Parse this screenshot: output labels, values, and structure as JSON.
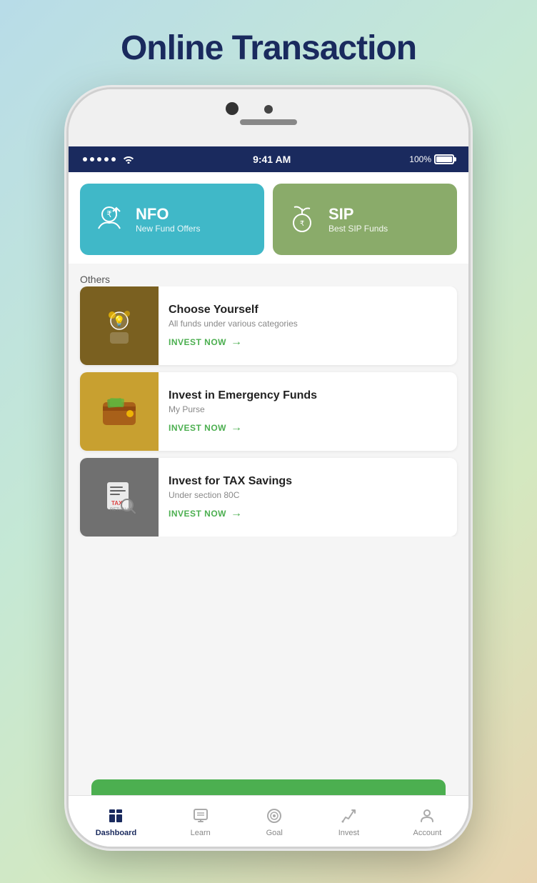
{
  "page": {
    "title": "Online Transaction",
    "background_colors": {
      "top": "#b8dce8",
      "mid": "#c5e8d5"
    }
  },
  "status_bar": {
    "time": "9:41 AM",
    "battery": "100%",
    "signal_dots": 5
  },
  "cards": [
    {
      "id": "nfo",
      "title": "NFO",
      "subtitle": "New Fund Offers",
      "bg_color": "#40b8c8"
    },
    {
      "id": "sip",
      "title": "SIP",
      "subtitle": "Best SIP Funds",
      "bg_color": "#8aab6a"
    }
  ],
  "others_label": "Others",
  "list_items": [
    {
      "id": "choose-yourself",
      "title": "Choose Yourself",
      "subtitle": "All funds under various categories",
      "cta": "INVEST NOW",
      "thumb_color": "#7a6020"
    },
    {
      "id": "emergency-funds",
      "title": "Invest in Emergency Funds",
      "subtitle": "My Purse",
      "cta": "INVEST NOW",
      "thumb_color": "#c8a030"
    },
    {
      "id": "tax-savings",
      "title": "Invest for TAX Savings",
      "subtitle": "Under section 80C",
      "cta": "INVEST NOW",
      "thumb_color": "#707070"
    }
  ],
  "nav": {
    "items": [
      {
        "id": "dashboard",
        "label": "Dashboard",
        "active": true
      },
      {
        "id": "learn",
        "label": "Learn",
        "active": false
      },
      {
        "id": "goal",
        "label": "Goal",
        "active": false
      },
      {
        "id": "invest",
        "label": "Invest",
        "active": false
      },
      {
        "id": "account",
        "label": "Account",
        "active": false
      }
    ]
  }
}
